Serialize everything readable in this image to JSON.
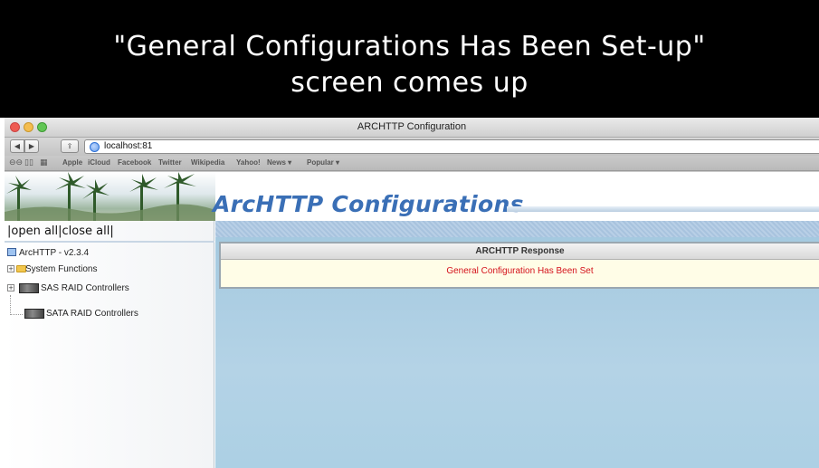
{
  "caption": {
    "line1": "\"General Configurations  Has Been Set-up\"",
    "line2": "screen comes up"
  },
  "window": {
    "title": "ARCHTTP Configuration"
  },
  "toolbar": {
    "back_glyph": "◀",
    "forward_glyph": "▶",
    "share_glyph": "⇪",
    "url": "localhost:81"
  },
  "bookmarks": {
    "items": [
      "Apple",
      "iCloud",
      "Facebook",
      "Twitter",
      "Wikipedia",
      "Yahoo!",
      "News ▾",
      "Popular ▾"
    ]
  },
  "page": {
    "header_title": "ArcHTTP Configurations",
    "open_close": "|open all|close all|",
    "tree": {
      "version": "ArcHTTP - v2.3.4",
      "system_functions": "System Functions",
      "sas": "SAS RAID Controllers",
      "sata": "SATA RAID Controllers"
    },
    "response": {
      "title": "ARCHTTP Response",
      "message": "General Configuration Has Been Set"
    }
  },
  "colors": {
    "header_title": "#3a6fb6",
    "message": "#d4121b",
    "main_bg": "#b4d3e6"
  }
}
